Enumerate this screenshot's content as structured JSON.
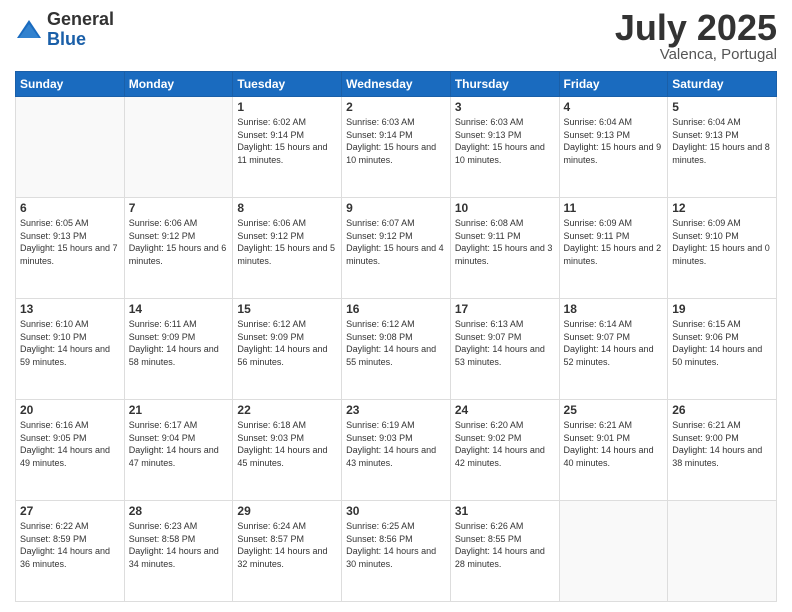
{
  "header": {
    "logo_general": "General",
    "logo_blue": "Blue",
    "month_year": "July 2025",
    "location": "Valenca, Portugal"
  },
  "days_of_week": [
    "Sunday",
    "Monday",
    "Tuesday",
    "Wednesday",
    "Thursday",
    "Friday",
    "Saturday"
  ],
  "weeks": [
    [
      {
        "day": "",
        "sunrise": "",
        "sunset": "",
        "daylight": ""
      },
      {
        "day": "",
        "sunrise": "",
        "sunset": "",
        "daylight": ""
      },
      {
        "day": "1",
        "sunrise": "Sunrise: 6:02 AM",
        "sunset": "Sunset: 9:14 PM",
        "daylight": "Daylight: 15 hours and 11 minutes."
      },
      {
        "day": "2",
        "sunrise": "Sunrise: 6:03 AM",
        "sunset": "Sunset: 9:14 PM",
        "daylight": "Daylight: 15 hours and 10 minutes."
      },
      {
        "day": "3",
        "sunrise": "Sunrise: 6:03 AM",
        "sunset": "Sunset: 9:13 PM",
        "daylight": "Daylight: 15 hours and 10 minutes."
      },
      {
        "day": "4",
        "sunrise": "Sunrise: 6:04 AM",
        "sunset": "Sunset: 9:13 PM",
        "daylight": "Daylight: 15 hours and 9 minutes."
      },
      {
        "day": "5",
        "sunrise": "Sunrise: 6:04 AM",
        "sunset": "Sunset: 9:13 PM",
        "daylight": "Daylight: 15 hours and 8 minutes."
      }
    ],
    [
      {
        "day": "6",
        "sunrise": "Sunrise: 6:05 AM",
        "sunset": "Sunset: 9:13 PM",
        "daylight": "Daylight: 15 hours and 7 minutes."
      },
      {
        "day": "7",
        "sunrise": "Sunrise: 6:06 AM",
        "sunset": "Sunset: 9:12 PM",
        "daylight": "Daylight: 15 hours and 6 minutes."
      },
      {
        "day": "8",
        "sunrise": "Sunrise: 6:06 AM",
        "sunset": "Sunset: 9:12 PM",
        "daylight": "Daylight: 15 hours and 5 minutes."
      },
      {
        "day": "9",
        "sunrise": "Sunrise: 6:07 AM",
        "sunset": "Sunset: 9:12 PM",
        "daylight": "Daylight: 15 hours and 4 minutes."
      },
      {
        "day": "10",
        "sunrise": "Sunrise: 6:08 AM",
        "sunset": "Sunset: 9:11 PM",
        "daylight": "Daylight: 15 hours and 3 minutes."
      },
      {
        "day": "11",
        "sunrise": "Sunrise: 6:09 AM",
        "sunset": "Sunset: 9:11 PM",
        "daylight": "Daylight: 15 hours and 2 minutes."
      },
      {
        "day": "12",
        "sunrise": "Sunrise: 6:09 AM",
        "sunset": "Sunset: 9:10 PM",
        "daylight": "Daylight: 15 hours and 0 minutes."
      }
    ],
    [
      {
        "day": "13",
        "sunrise": "Sunrise: 6:10 AM",
        "sunset": "Sunset: 9:10 PM",
        "daylight": "Daylight: 14 hours and 59 minutes."
      },
      {
        "day": "14",
        "sunrise": "Sunrise: 6:11 AM",
        "sunset": "Sunset: 9:09 PM",
        "daylight": "Daylight: 14 hours and 58 minutes."
      },
      {
        "day": "15",
        "sunrise": "Sunrise: 6:12 AM",
        "sunset": "Sunset: 9:09 PM",
        "daylight": "Daylight: 14 hours and 56 minutes."
      },
      {
        "day": "16",
        "sunrise": "Sunrise: 6:12 AM",
        "sunset": "Sunset: 9:08 PM",
        "daylight": "Daylight: 14 hours and 55 minutes."
      },
      {
        "day": "17",
        "sunrise": "Sunrise: 6:13 AM",
        "sunset": "Sunset: 9:07 PM",
        "daylight": "Daylight: 14 hours and 53 minutes."
      },
      {
        "day": "18",
        "sunrise": "Sunrise: 6:14 AM",
        "sunset": "Sunset: 9:07 PM",
        "daylight": "Daylight: 14 hours and 52 minutes."
      },
      {
        "day": "19",
        "sunrise": "Sunrise: 6:15 AM",
        "sunset": "Sunset: 9:06 PM",
        "daylight": "Daylight: 14 hours and 50 minutes."
      }
    ],
    [
      {
        "day": "20",
        "sunrise": "Sunrise: 6:16 AM",
        "sunset": "Sunset: 9:05 PM",
        "daylight": "Daylight: 14 hours and 49 minutes."
      },
      {
        "day": "21",
        "sunrise": "Sunrise: 6:17 AM",
        "sunset": "Sunset: 9:04 PM",
        "daylight": "Daylight: 14 hours and 47 minutes."
      },
      {
        "day": "22",
        "sunrise": "Sunrise: 6:18 AM",
        "sunset": "Sunset: 9:03 PM",
        "daylight": "Daylight: 14 hours and 45 minutes."
      },
      {
        "day": "23",
        "sunrise": "Sunrise: 6:19 AM",
        "sunset": "Sunset: 9:03 PM",
        "daylight": "Daylight: 14 hours and 43 minutes."
      },
      {
        "day": "24",
        "sunrise": "Sunrise: 6:20 AM",
        "sunset": "Sunset: 9:02 PM",
        "daylight": "Daylight: 14 hours and 42 minutes."
      },
      {
        "day": "25",
        "sunrise": "Sunrise: 6:21 AM",
        "sunset": "Sunset: 9:01 PM",
        "daylight": "Daylight: 14 hours and 40 minutes."
      },
      {
        "day": "26",
        "sunrise": "Sunrise: 6:21 AM",
        "sunset": "Sunset: 9:00 PM",
        "daylight": "Daylight: 14 hours and 38 minutes."
      }
    ],
    [
      {
        "day": "27",
        "sunrise": "Sunrise: 6:22 AM",
        "sunset": "Sunset: 8:59 PM",
        "daylight": "Daylight: 14 hours and 36 minutes."
      },
      {
        "day": "28",
        "sunrise": "Sunrise: 6:23 AM",
        "sunset": "Sunset: 8:58 PM",
        "daylight": "Daylight: 14 hours and 34 minutes."
      },
      {
        "day": "29",
        "sunrise": "Sunrise: 6:24 AM",
        "sunset": "Sunset: 8:57 PM",
        "daylight": "Daylight: 14 hours and 32 minutes."
      },
      {
        "day": "30",
        "sunrise": "Sunrise: 6:25 AM",
        "sunset": "Sunset: 8:56 PM",
        "daylight": "Daylight: 14 hours and 30 minutes."
      },
      {
        "day": "31",
        "sunrise": "Sunrise: 6:26 AM",
        "sunset": "Sunset: 8:55 PM",
        "daylight": "Daylight: 14 hours and 28 minutes."
      },
      {
        "day": "",
        "sunrise": "",
        "sunset": "",
        "daylight": ""
      },
      {
        "day": "",
        "sunrise": "",
        "sunset": "",
        "daylight": ""
      }
    ]
  ]
}
